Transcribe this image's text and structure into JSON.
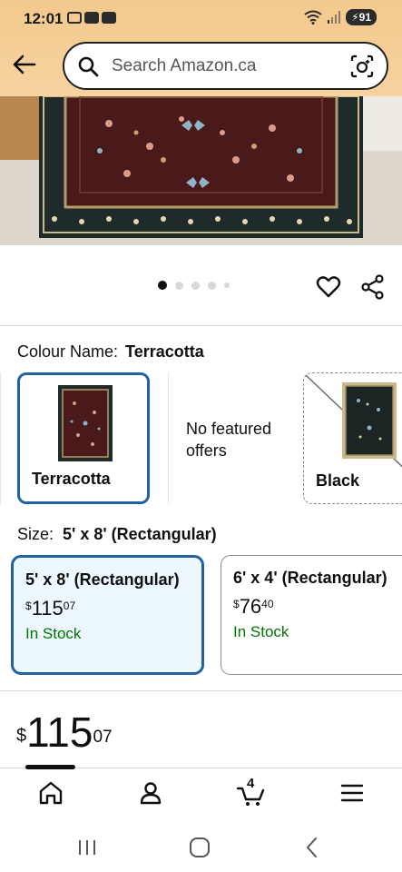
{
  "status_bar": {
    "time": "12:01",
    "battery": "91"
  },
  "search": {
    "placeholder": "Search Amazon.ca"
  },
  "carousel": {
    "count": 5,
    "active_index": 0
  },
  "colour": {
    "label": "Colour Name:",
    "selected_value": "Terracotta",
    "options": [
      {
        "label": "Terracotta"
      },
      {
        "label": "No featured offers"
      },
      {
        "label": "Black"
      }
    ]
  },
  "size": {
    "label": "Size:",
    "selected_value": "5' x 8' (Rectangular)",
    "options": [
      {
        "name": "5' x 8' (Rectangular)",
        "currency": "$",
        "price_whole": "115",
        "price_cents": "07",
        "stock": "In Stock"
      },
      {
        "name": "6' x 4' (Rectangular)",
        "currency": "$",
        "price_whole": "76",
        "price_cents": "40",
        "stock": "In Stock"
      }
    ]
  },
  "price": {
    "currency": "$",
    "whole": "115",
    "cents": "07"
  },
  "bottom_nav": {
    "cart_count": "4"
  },
  "colors": {
    "accent_blue": "#2162a1",
    "in_stock_green": "#007600",
    "header_gradient": "#f3c98d",
    "rug_maroon": "#4a1a1a"
  }
}
